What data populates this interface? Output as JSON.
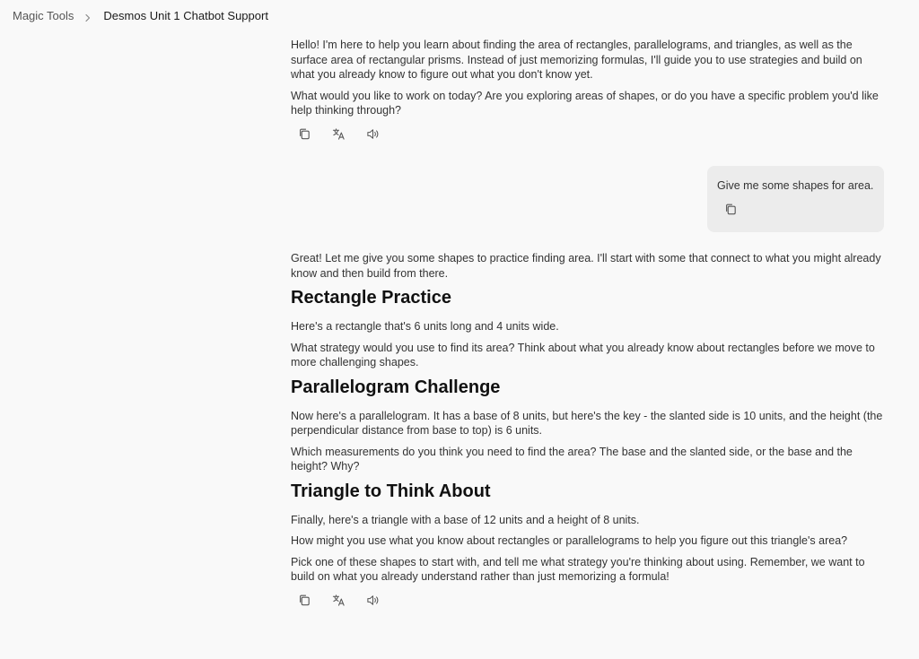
{
  "breadcrumb": {
    "root": "Magic Tools",
    "current": "Desmos Unit 1 Chatbot Support"
  },
  "message1": {
    "paragraphs": [
      "Hello! I'm here to help you learn about finding the area of rectangles, parallelograms, and triangles, as well as the surface area of rectangular prisms. Instead of just memorizing formulas, I'll guide you to use strategies and build on what you already know to figure out what you don't know yet.",
      "What would you like to work on today? Are you exploring areas of shapes, or do you have a specific problem you'd like help thinking through?"
    ]
  },
  "user_message": {
    "text": "Give me some shapes for area."
  },
  "message2": {
    "intro": "Great! Let me give you some shapes to practice finding area. I'll start with some that connect to what you might already know and then build from there.",
    "sections": [
      {
        "heading": "Rectangle Practice",
        "paragraphs": [
          "Here's a rectangle that's 6 units long and 4 units wide.",
          "What strategy would you use to find its area? Think about what you already know about rectangles before we move to more challenging shapes."
        ]
      },
      {
        "heading": "Parallelogram Challenge",
        "paragraphs": [
          "Now here's a parallelogram. It has a base of 8 units, but here's the key - the slanted side is 10 units, and the height (the perpendicular distance from base to top) is 6 units.",
          "Which measurements do you think you need to find the area? The base and the slanted side, or the base and the height? Why?"
        ]
      },
      {
        "heading": "Triangle to Think About",
        "paragraphs": [
          "Finally, here's a triangle with a base of 12 units and a height of 8 units.",
          "How might you use what you know about rectangles or parallelograms to help you figure out this triangle's area?",
          "Pick one of these shapes to start with, and tell me what strategy you're thinking about using. Remember, we want to build on what you already understand rather than just memorizing a formula!"
        ]
      }
    ]
  },
  "icons": {
    "copy": "copy-icon",
    "translate": "translate-icon",
    "speaker": "speaker-icon"
  }
}
